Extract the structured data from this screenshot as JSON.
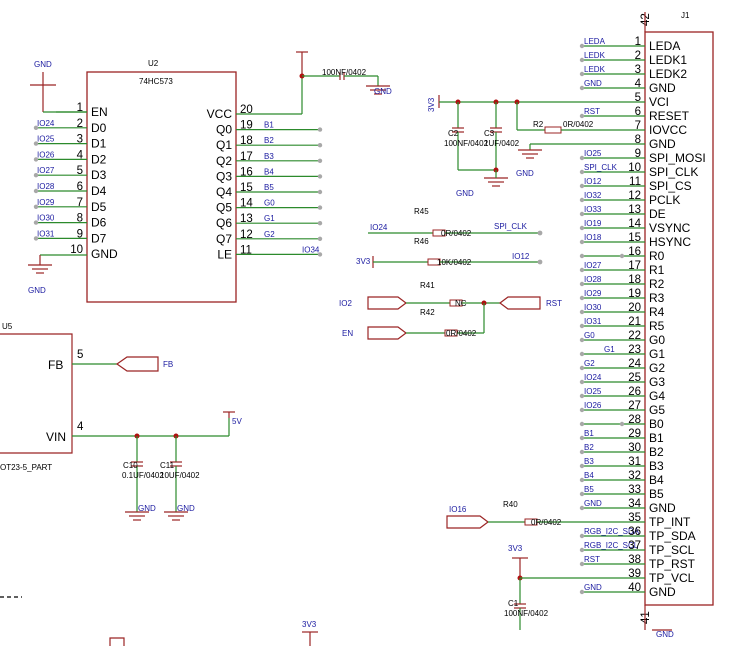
{
  "u2": {
    "ref": "U2",
    "part": "74HC573",
    "left_pins": [
      {
        "num": "1",
        "name": "EN"
      },
      {
        "num": "2",
        "name": "D0",
        "net": "IO24"
      },
      {
        "num": "3",
        "name": "D1",
        "net": "IO25"
      },
      {
        "num": "4",
        "name": "D2",
        "net": "IO26"
      },
      {
        "num": "5",
        "name": "D3",
        "net": "IO27"
      },
      {
        "num": "6",
        "name": "D4",
        "net": "IO28"
      },
      {
        "num": "7",
        "name": "D5",
        "net": "IO29"
      },
      {
        "num": "8",
        "name": "D6",
        "net": "IO30"
      },
      {
        "num": "9",
        "name": "D7",
        "net": "IO31"
      },
      {
        "num": "10",
        "name": "GND"
      }
    ],
    "right_pins": [
      {
        "num": "20",
        "name": "VCC"
      },
      {
        "num": "19",
        "name": "Q0",
        "net": "B1"
      },
      {
        "num": "18",
        "name": "Q1",
        "net": "B2"
      },
      {
        "num": "17",
        "name": "Q2",
        "net": "B3"
      },
      {
        "num": "16",
        "name": "Q3",
        "net": "B4"
      },
      {
        "num": "15",
        "name": "Q4",
        "net": "B5"
      },
      {
        "num": "14",
        "name": "Q5",
        "net": "G0"
      },
      {
        "num": "13",
        "name": "Q6",
        "net": "G1"
      },
      {
        "num": "12",
        "name": "Q7",
        "net": "G2"
      },
      {
        "num": "11",
        "name": "LE",
        "net": "IO34"
      }
    ],
    "gnd_top": "GND",
    "gnd_bottom": "GND",
    "cap_value": "100NF/0402"
  },
  "j1": {
    "ref": "J1",
    "top_pin": "42",
    "bottom_pin": "41",
    "pins": [
      {
        "num": "1",
        "name": "LEDA",
        "net": "LEDA"
      },
      {
        "num": "2",
        "name": "LEDK1",
        "net": "LEDK"
      },
      {
        "num": "3",
        "name": "LEDK2",
        "net": "LEDK"
      },
      {
        "num": "4",
        "name": "GND",
        "net": "GND"
      },
      {
        "num": "5",
        "name": "VCI",
        "net": ""
      },
      {
        "num": "6",
        "name": "RESET",
        "net": "RST"
      },
      {
        "num": "7",
        "name": "IOVCC",
        "net": ""
      },
      {
        "num": "8",
        "name": "GND",
        "net": ""
      },
      {
        "num": "9",
        "name": "SPI_MOSI",
        "net": "IO25"
      },
      {
        "num": "10",
        "name": "SPI_CLK",
        "net": "SPI_CLK"
      },
      {
        "num": "11",
        "name": "SPI_CS",
        "net": "IO12"
      },
      {
        "num": "12",
        "name": "PCLK",
        "net": "IO32"
      },
      {
        "num": "13",
        "name": "DE",
        "net": "IO33"
      },
      {
        "num": "14",
        "name": "VSYNC",
        "net": "IO19"
      },
      {
        "num": "15",
        "name": "HSYNC",
        "net": "IO18"
      },
      {
        "num": "16",
        "name": "R0",
        "net": ""
      },
      {
        "num": "17",
        "name": "R1",
        "net": "IO27"
      },
      {
        "num": "18",
        "name": "R2",
        "net": "IO28"
      },
      {
        "num": "19",
        "name": "R3",
        "net": "IO29"
      },
      {
        "num": "20",
        "name": "R4",
        "net": "IO30"
      },
      {
        "num": "21",
        "name": "R5",
        "net": "IO31"
      },
      {
        "num": "22",
        "name": "G0",
        "net": "G0"
      },
      {
        "num": "23",
        "name": "G1",
        "net": "G1"
      },
      {
        "num": "24",
        "name": "G2",
        "net": "G2"
      },
      {
        "num": "25",
        "name": "G3",
        "net": "IO24"
      },
      {
        "num": "26",
        "name": "G4",
        "net": "IO25"
      },
      {
        "num": "27",
        "name": "G5",
        "net": "IO26"
      },
      {
        "num": "28",
        "name": "B0",
        "net": ""
      },
      {
        "num": "29",
        "name": "B1",
        "net": "B1"
      },
      {
        "num": "30",
        "name": "B2",
        "net": "B2"
      },
      {
        "num": "31",
        "name": "B3",
        "net": "B3"
      },
      {
        "num": "32",
        "name": "B4",
        "net": "B4"
      },
      {
        "num": "33",
        "name": "B5",
        "net": "B5"
      },
      {
        "num": "34",
        "name": "GND",
        "net": "GND"
      },
      {
        "num": "35",
        "name": "TP_INT",
        "net": ""
      },
      {
        "num": "36",
        "name": "TP_SDA",
        "net": "RGB_I2C_SDA"
      },
      {
        "num": "37",
        "name": "TP_SCL",
        "net": "RGB_I2C_SCL"
      },
      {
        "num": "38",
        "name": "TP_RST",
        "net": "RST"
      },
      {
        "num": "39",
        "name": "TP_VCL",
        "net": ""
      },
      {
        "num": "40",
        "name": "GND",
        "net": "GND"
      }
    ],
    "gnd_bottom": "GND"
  },
  "power": {
    "v3v3_label": "3V3",
    "c2": {
      "ref": "C2",
      "value": "100NF/0402"
    },
    "c3": {
      "ref": "C3",
      "value": "1UF/0402"
    },
    "r2": {
      "ref": "R2",
      "value": "0R/0402"
    },
    "gnd_a": "GND",
    "gnd_b": "GND"
  },
  "resistors": {
    "r45": {
      "ref": "R45",
      "value": "0R/0402",
      "left_net": "IO24",
      "right_net": "SPI_CLK"
    },
    "r46": {
      "ref": "R46",
      "value": "10K/0402",
      "left_net": "3V3",
      "right_net": "IO12"
    },
    "r41": {
      "ref": "R41",
      "value": "NC",
      "port": "IO2"
    },
    "r42": {
      "ref": "R42",
      "value": "0R/0402",
      "port": "EN"
    },
    "rst_port": "RST",
    "r40": {
      "ref": "R40",
      "value": "0R/0402",
      "port": "IO16"
    }
  },
  "u5": {
    "ref": "U5",
    "pin_fb_num": "5",
    "pin_fb": "FB",
    "pin_vin_num": "4",
    "pin_vin": "VIN",
    "package": "OT23-5_PART",
    "fb_port": "FB",
    "v5_label": "5V",
    "c10": {
      "ref": "C10",
      "value": "0.1UF/0402"
    },
    "c11": {
      "ref": "C11",
      "value": "10UF/0402"
    },
    "gnd_a": "GND",
    "gnd_b": "GND"
  },
  "bottom": {
    "v3v3_label": "3V3",
    "c1": {
      "ref": "C1",
      "value": "100NF/0402"
    },
    "v3v3_label_2": "3V3"
  }
}
